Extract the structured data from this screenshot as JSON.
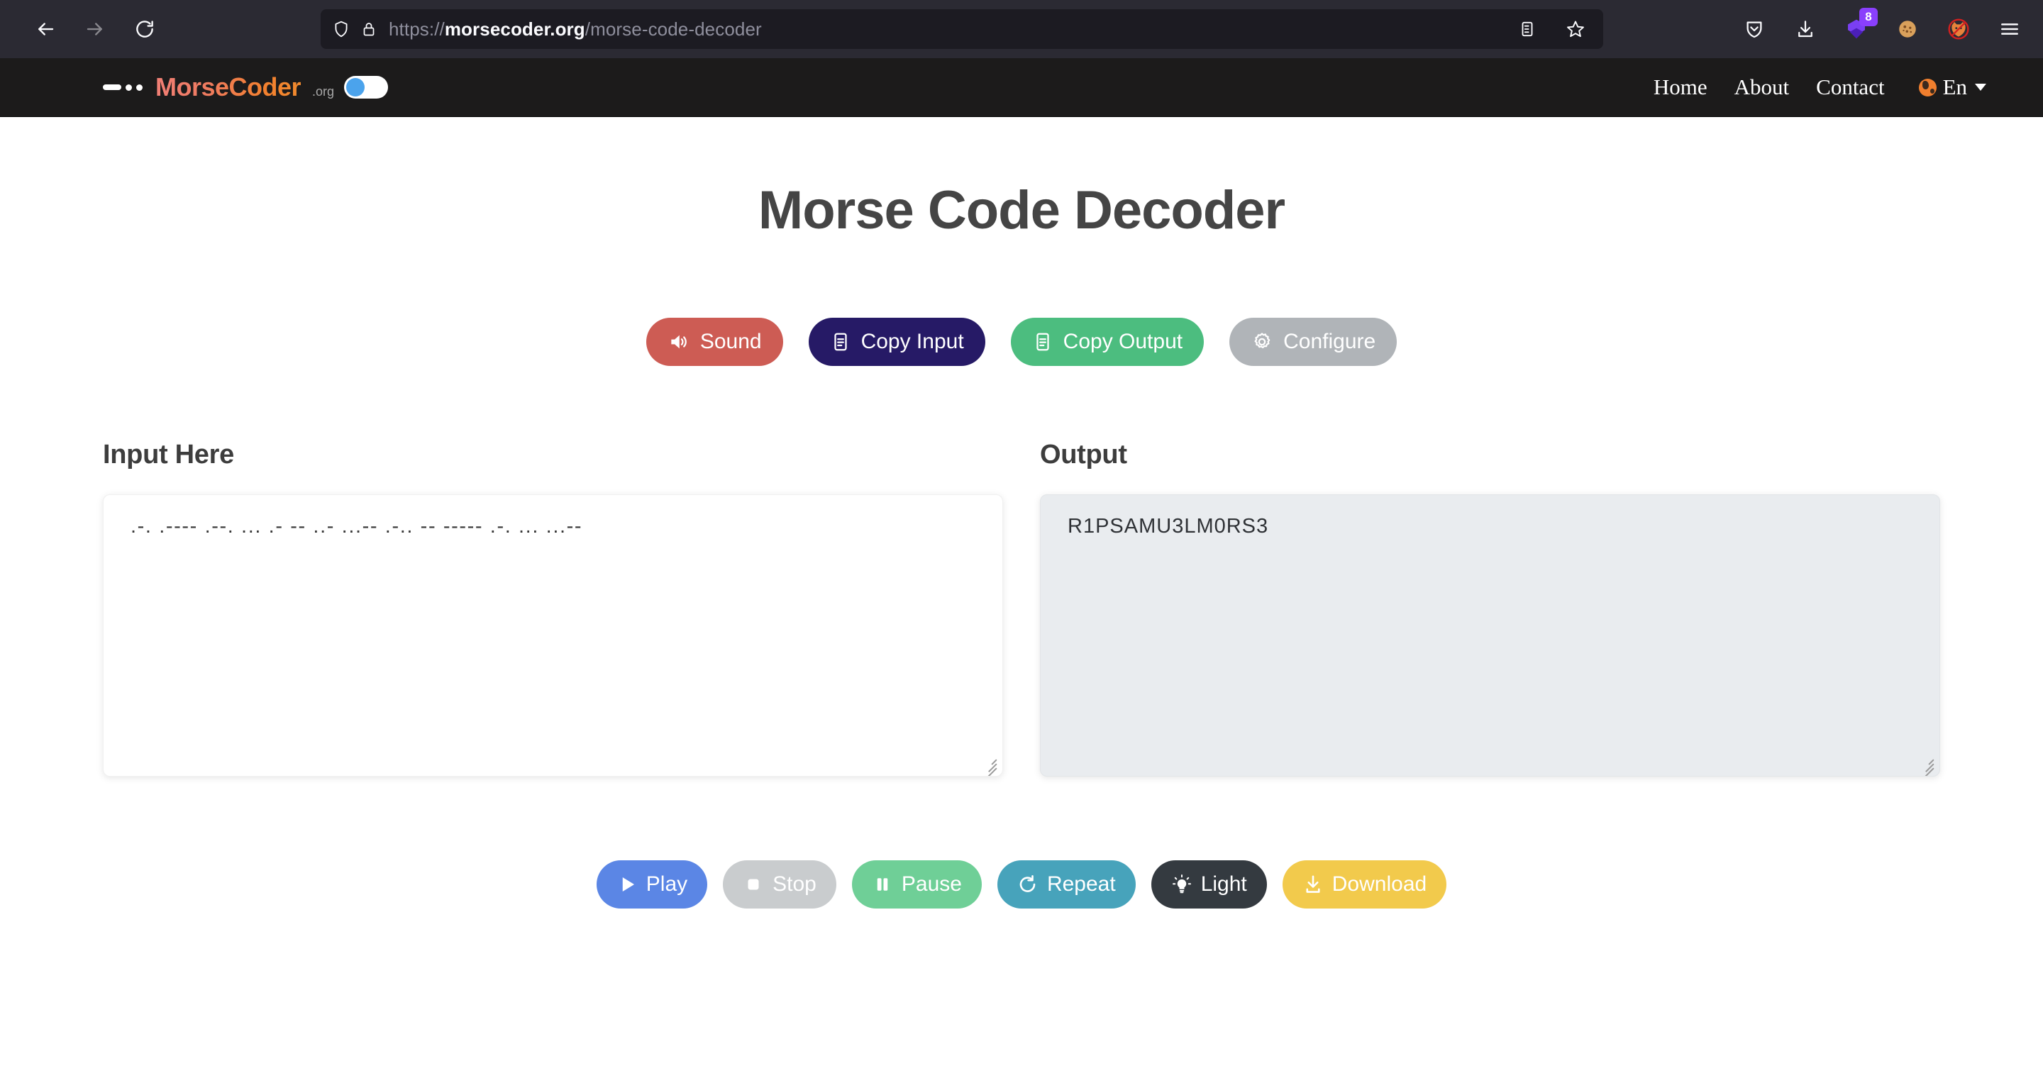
{
  "browser": {
    "url_prefix": "https://",
    "url_host": "morsecoder.org",
    "url_path": "/morse-code-decoder",
    "extension_badge_count": "8"
  },
  "site_header": {
    "brand_name": "MorseCoder",
    "brand_tld": ".org",
    "nav": [
      {
        "label": "Home"
      },
      {
        "label": "About"
      },
      {
        "label": "Contact"
      }
    ],
    "language": "En"
  },
  "main": {
    "title": "Morse Code Decoder",
    "actions": [
      {
        "label": "Sound",
        "icon": "speaker-icon",
        "color": "#cd5c54"
      },
      {
        "label": "Copy Input",
        "icon": "document-icon",
        "color": "#261a66"
      },
      {
        "label": "Copy Output",
        "icon": "document-icon",
        "color": "#4cbd7f"
      },
      {
        "label": "Configure",
        "icon": "gear-icon",
        "color": "#b0b4b8"
      }
    ],
    "input": {
      "label": "Input Here",
      "value": ".-. .---- .--. ... .- -- ..- ...-- .-.. -- ----- .-. ... ...--"
    },
    "output": {
      "label": "Output",
      "value": "R1PSAMU3LM0RS3"
    },
    "player": [
      {
        "label": "Play",
        "icon": "play-icon",
        "color": "#5b86e5"
      },
      {
        "label": "Stop",
        "icon": "stop-icon",
        "color": "#c9ccce"
      },
      {
        "label": "Pause",
        "icon": "pause-icon",
        "color": "#6fcf97"
      },
      {
        "label": "Repeat",
        "icon": "repeat-icon",
        "color": "#47a3bb"
      },
      {
        "label": "Light",
        "icon": "bulb-icon",
        "color": "#343a40"
      },
      {
        "label": "Download",
        "icon": "download-icon",
        "color": "#f2ca4c"
      }
    ]
  }
}
